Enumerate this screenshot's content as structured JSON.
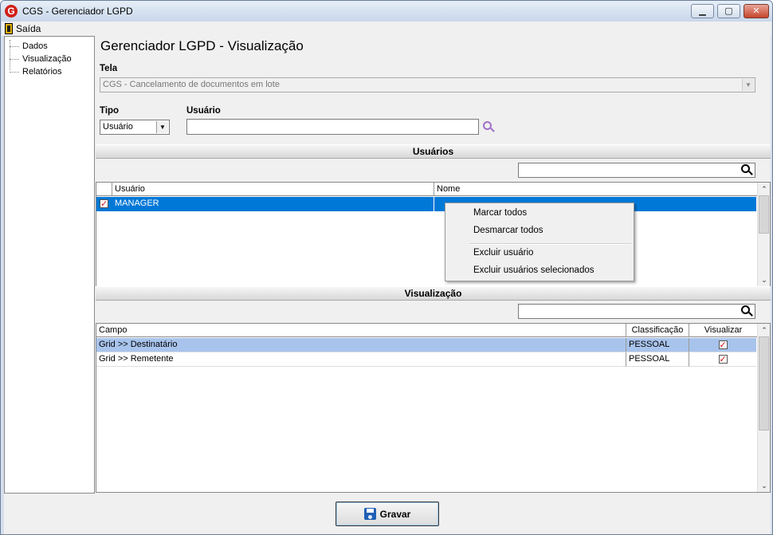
{
  "window": {
    "title": "CGS - Gerenciador LGPD",
    "minimize_glyph": "▁",
    "maximize_glyph": "▢",
    "close_glyph": "✕"
  },
  "menu": {
    "exit_label": "Saída"
  },
  "tree": {
    "items": [
      {
        "label": "Dados"
      },
      {
        "label": "Visualização"
      },
      {
        "label": "Relatórios"
      }
    ]
  },
  "main": {
    "title": "Gerenciador LGPD - Visualização",
    "tela_label": "Tela",
    "tela_value": "CGS - Cancelamento de documentos em lote",
    "tipo_label": "Tipo",
    "tipo_value": "Usuário",
    "usuario_label": "Usuário",
    "usuario_value": ""
  },
  "usuarios": {
    "section_title": "Usuários",
    "filter_value": "",
    "columns": [
      "Usuário",
      "Nome"
    ],
    "rows": [
      {
        "checked": true,
        "usuario": "MANAGER",
        "nome": ""
      }
    ]
  },
  "context_menu": {
    "items": [
      "Marcar todos",
      "Desmarcar todos",
      "Excluir usuário",
      "Excluir usuários selecionados"
    ]
  },
  "visualizacao": {
    "section_title": "Visualização",
    "filter_value": "",
    "columns": [
      "Campo",
      "Classificação",
      "Visualizar"
    ],
    "rows": [
      {
        "campo": "Grid >> Destinatário",
        "classificacao": "PESSOAL",
        "visualizar": true
      },
      {
        "campo": "Grid >> Remetente",
        "classificacao": "PESSOAL",
        "visualizar": true
      }
    ]
  },
  "footer": {
    "save_label": "Gravar"
  },
  "colors": {
    "selection": "#0078d7",
    "row_highlight": "#a8c4ec",
    "check_mark": "#d01010",
    "accent_search": "#a070c8"
  },
  "scroll": {
    "up_glyph": "⌃",
    "down_glyph": "⌄",
    "combo_arrow": "▼"
  }
}
